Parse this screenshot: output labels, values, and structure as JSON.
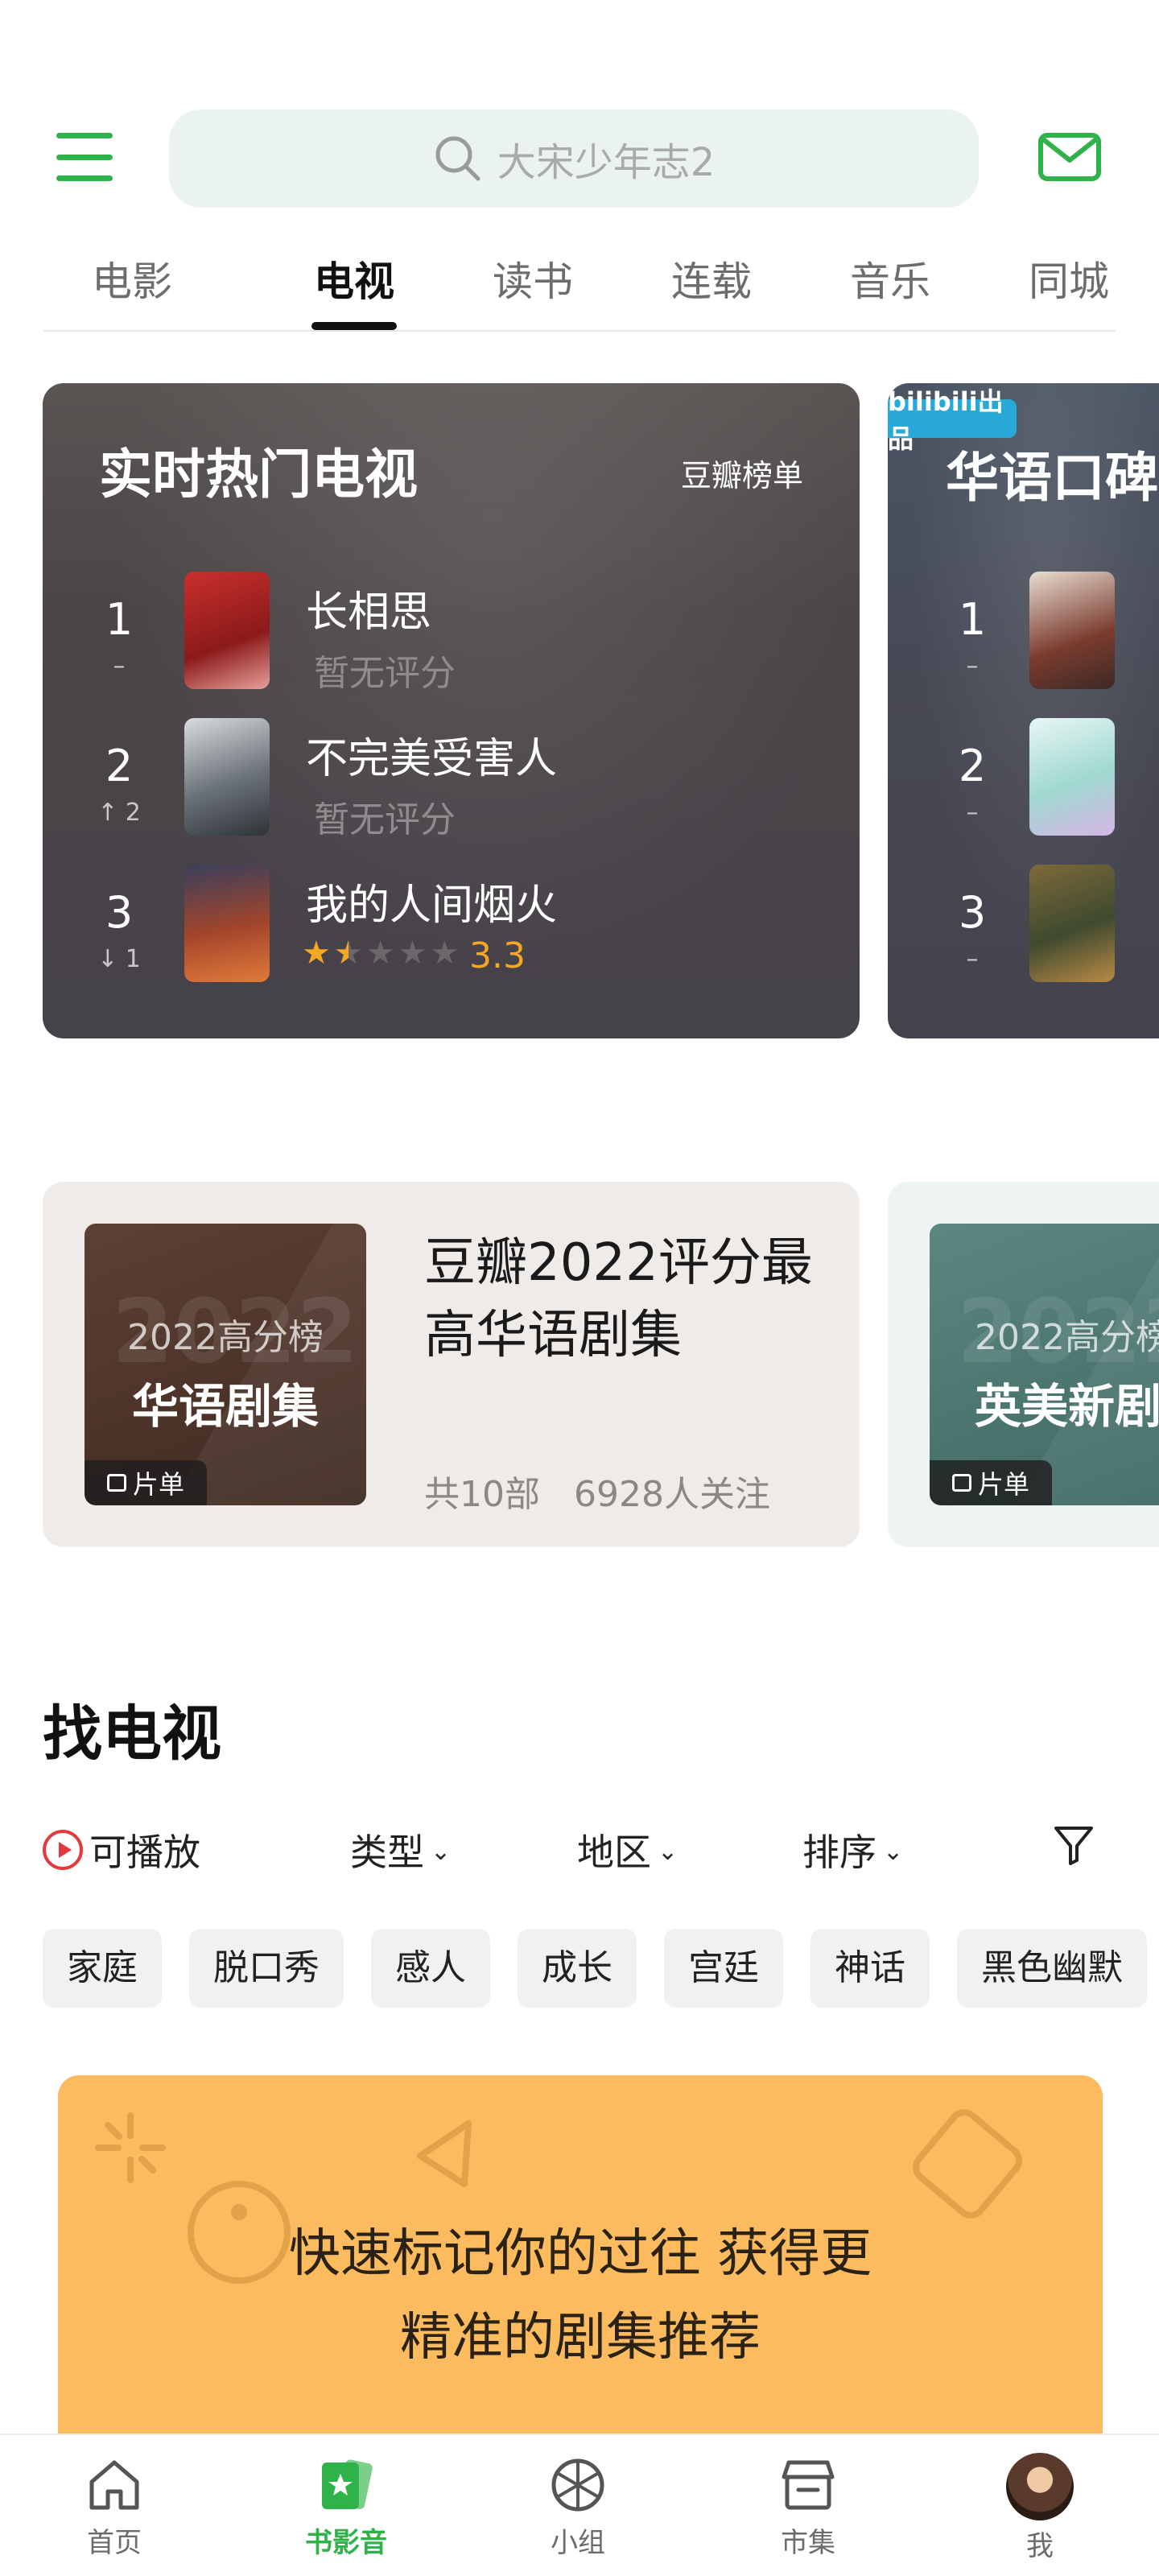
{
  "search": {
    "placeholder": "大宋少年志2"
  },
  "tabs": [
    {
      "label": "电影",
      "active": false
    },
    {
      "label": "电视",
      "active": true
    },
    {
      "label": "读书",
      "active": false
    },
    {
      "label": "连载",
      "active": false
    },
    {
      "label": "音乐",
      "active": false
    },
    {
      "label": "同城",
      "active": false
    }
  ],
  "rank_main": {
    "title": "实时热门电视",
    "source": "豆瓣榜单",
    "items": [
      {
        "rank": "1",
        "change": "–",
        "name": "长相思",
        "score_text": "暂无评分"
      },
      {
        "rank": "2",
        "change": "↑ 2",
        "name": "不完美受害人",
        "score_text": "暂无评分"
      },
      {
        "rank": "3",
        "change": "↓ 1",
        "name": "我的人间烟火",
        "rating": "3.3",
        "stars": 1.5
      }
    ]
  },
  "rank_second": {
    "badge": "bilibili出品",
    "title": "华语口碑",
    "items": [
      {
        "rank": "1",
        "change": "–"
      },
      {
        "rank": "2",
        "change": "–"
      },
      {
        "rank": "3",
        "change": "–"
      }
    ]
  },
  "collection_main": {
    "cover_year": "2022高分榜",
    "cover_bg_year": "2022",
    "cover_name": "华语剧集",
    "tag": "片单",
    "title": "豆瓣2022评分最高华语剧集",
    "count": "共10部",
    "followers": "6928人关注"
  },
  "collection_second": {
    "cover_year": "2022高分榜",
    "cover_bg_year": "2022",
    "cover_name": "英美新剧",
    "tag": "片单"
  },
  "find": {
    "title": "找电视",
    "playable": "可播放",
    "filters": [
      "类型",
      "地区",
      "排序"
    ]
  },
  "chips": [
    "家庭",
    "脱口秀",
    "感人",
    "成长",
    "宫廷",
    "神话",
    "黑色幽默"
  ],
  "banner": {
    "line1": "快速标记你的过往 获得更",
    "line2": "精准的剧集推荐"
  },
  "bottom_nav": [
    {
      "label": "首页",
      "active": false
    },
    {
      "label": "书影音",
      "active": true
    },
    {
      "label": "小组",
      "active": false
    },
    {
      "label": "市集",
      "active": false
    },
    {
      "label": "我",
      "active": false
    }
  ],
  "colors": {
    "brand_green": "#2fb24a",
    "star": "#f5a623",
    "banner": "#fbbb5e"
  }
}
